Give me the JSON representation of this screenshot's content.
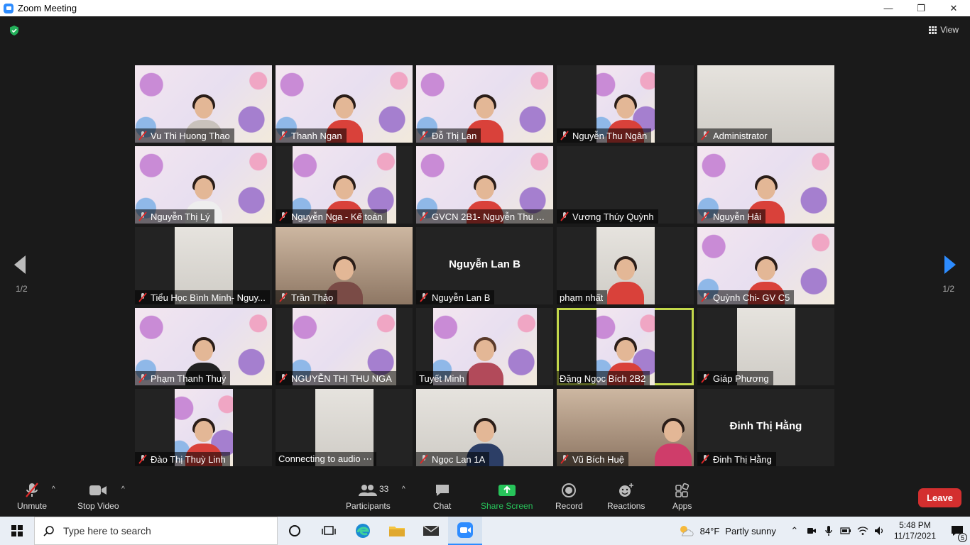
{
  "window": {
    "title": "Zoom Meeting"
  },
  "stage": {
    "view_label": "View",
    "page_left": "1/2",
    "page_right": "1/2"
  },
  "tiles": [
    {
      "name": "Vu Thi Huong Thao"
    },
    {
      "name": "Thanh Ngan"
    },
    {
      "name": "Đỗ Thị Lan"
    },
    {
      "name": "Nguyễn Thu Ngân"
    },
    {
      "name": "Administrator"
    },
    {
      "name": "Nguyễn Thị Lý"
    },
    {
      "name": "Nguyễn Nga - Kế toán"
    },
    {
      "name": "GVCN 2B1- Nguyễn Thu Tr..."
    },
    {
      "name": "Vương Thúy Quỳnh"
    },
    {
      "name": "Nguyễn Hải"
    },
    {
      "name": "Tiểu Học Bình Minh- Nguy..."
    },
    {
      "name": "Trần Thảo"
    },
    {
      "name": "Nguyễn Lan B",
      "center": "Nguyễn Lan B"
    },
    {
      "name": "phạm nhất"
    },
    {
      "name": "Quỳnh Chi- GV C5"
    },
    {
      "name": "Phạm  Thanh  Thuý"
    },
    {
      "name": "NGUYỄN THỊ THU NGA"
    },
    {
      "name": "Tuyết Minh"
    },
    {
      "name": "Đặng Ngọc Bích 2B2"
    },
    {
      "name": "Giáp Phương"
    },
    {
      "name": "Đào Thị Thuỳ Linh"
    },
    {
      "name": "Connecting to audio ⋯"
    },
    {
      "name": "Ngọc Lan 1A"
    },
    {
      "name": "Vũ Bích Huệ"
    },
    {
      "name": "Đinh Thị Hằng",
      "center": "Đinh Thị Hằng"
    }
  ],
  "toolbar": {
    "unmute": "Unmute",
    "stop_video": "Stop Video",
    "participants": "Participants",
    "participants_count": "33",
    "chat": "Chat",
    "share_screen": "Share Screen",
    "record": "Record",
    "reactions": "Reactions",
    "apps": "Apps",
    "leave": "Leave"
  },
  "taskbar": {
    "search_placeholder": "Type here to search",
    "temperature": "84°F",
    "weather": "Partly sunny",
    "time": "5:48 PM",
    "date": "11/17/2021",
    "notifications": "5"
  }
}
